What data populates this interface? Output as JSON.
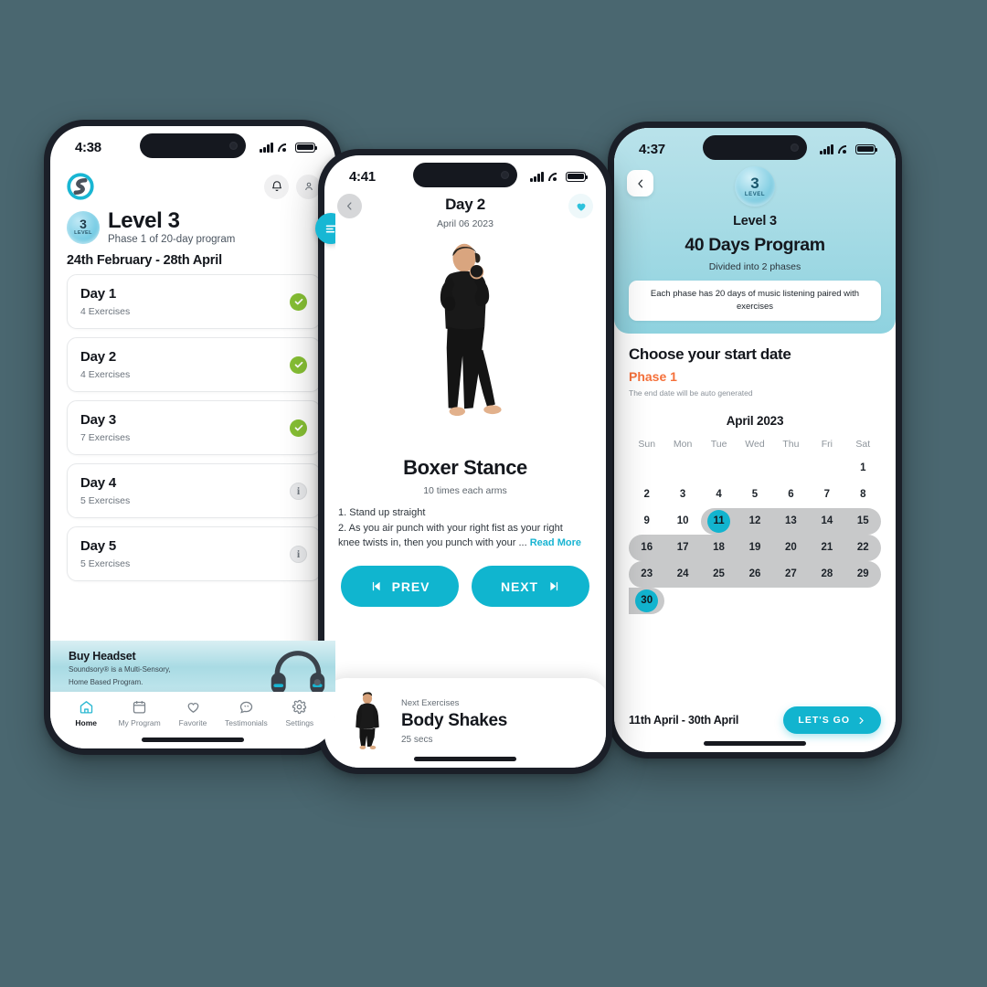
{
  "background_color": "#4a6770",
  "accent_color": "#12b4cf",
  "phone1": {
    "status": {
      "time": "4:38"
    },
    "logo_icon": "soundsory-s-logo-icon",
    "header_icons": [
      {
        "name": "notification-bell-icon",
        "glyph": "bell"
      },
      {
        "name": "account-user-icon",
        "glyph": "user"
      }
    ],
    "level_badge": {
      "number": "3",
      "label": "LEVEL"
    },
    "title": "Level 3",
    "subtitle": "Phase 1 of 20-day program",
    "date_range": "24th February - 28th April",
    "fab_icon": "filter-sort-icon",
    "days": [
      {
        "name": "Day 1",
        "exercises": "4 Exercises",
        "status": "complete"
      },
      {
        "name": "Day 2",
        "exercises": "4 Exercises",
        "status": "complete"
      },
      {
        "name": "Day 3",
        "exercises": "7 Exercises",
        "status": "complete"
      },
      {
        "name": "Day 4",
        "exercises": "5 Exercises",
        "status": "info"
      },
      {
        "name": "Day 5",
        "exercises": "5 Exercises",
        "status": "info"
      }
    ],
    "promo": {
      "title": "Buy Headset",
      "line1": "Soundsory® is a Multi-Sensory,",
      "line2": "Home Based Program.",
      "image": "headphones-icon"
    },
    "tabs": [
      {
        "label": "Home",
        "icon": "home-icon",
        "active": true
      },
      {
        "label": "My Program",
        "icon": "calendar-icon",
        "active": false
      },
      {
        "label": "Favorite",
        "icon": "heart-icon",
        "active": false
      },
      {
        "label": "Testimonials",
        "icon": "quote-bubble-icon",
        "active": false
      },
      {
        "label": "Settings",
        "icon": "gear-icon",
        "active": false
      }
    ]
  },
  "phone2": {
    "status": {
      "time": "4:41"
    },
    "back_icon": "chevron-left-icon",
    "favorite_icon": "heart-filled-icon",
    "title": "Day 2",
    "date": "April 06 2023",
    "hero_image": "boxer-stance-woman-photo",
    "exercise_name": "Boxer Stance",
    "reps": "10 times each arms",
    "steps_line1": "1. Stand up straight",
    "steps_line2": "2. As you air punch with your right fist as your right",
    "steps_line3": "knee twists in, then you punch with your ...",
    "read_more": "Read More",
    "prev_label": "PREV",
    "next_label": "NEXT",
    "next_card": {
      "eyebrow": "Next Exercises",
      "name": "Body Shakes",
      "duration": "25 secs",
      "image": "body-shakes-figure-photo"
    }
  },
  "phone3": {
    "status": {
      "time": "4:37"
    },
    "back_icon": "chevron-left-icon",
    "level_badge": {
      "number": "3",
      "label": "LEVEL"
    },
    "level_text": "Level 3",
    "program_title": "40 Days Program",
    "divided_text": "Divided into 2 phases",
    "note": "Each phase has 20 days of music listening paired with exercises",
    "section_title": "Choose your start date",
    "phase": "Phase 1",
    "auto_note": "The end date will be auto generated",
    "calendar": {
      "month": "April 2023",
      "dow": [
        "Sun",
        "Mon",
        "Tue",
        "Wed",
        "Thu",
        "Fri",
        "Sat"
      ],
      "weeks": [
        [
          {
            "d": ""
          },
          {
            "d": ""
          },
          {
            "d": ""
          },
          {
            "d": ""
          },
          {
            "d": ""
          },
          {
            "d": ""
          },
          {
            "d": "1"
          }
        ],
        [
          {
            "d": "2"
          },
          {
            "d": "3"
          },
          {
            "d": "4"
          },
          {
            "d": "5"
          },
          {
            "d": "6"
          },
          {
            "d": "7"
          },
          {
            "d": "8"
          }
        ],
        [
          {
            "d": "9"
          },
          {
            "d": "10"
          },
          {
            "d": "11",
            "sel": true,
            "range": "start"
          },
          {
            "d": "12",
            "range": "mid"
          },
          {
            "d": "13",
            "range": "mid"
          },
          {
            "d": "14",
            "range": "mid"
          },
          {
            "d": "15",
            "range": "end"
          }
        ],
        [
          {
            "d": "16",
            "range": "start"
          },
          {
            "d": "17",
            "range": "mid"
          },
          {
            "d": "18",
            "range": "mid"
          },
          {
            "d": "19",
            "range": "mid"
          },
          {
            "d": "20",
            "range": "mid"
          },
          {
            "d": "21",
            "range": "mid"
          },
          {
            "d": "22",
            "range": "end"
          }
        ],
        [
          {
            "d": "23",
            "range": "start"
          },
          {
            "d": "24",
            "range": "mid"
          },
          {
            "d": "25",
            "range": "mid"
          },
          {
            "d": "26",
            "range": "mid"
          },
          {
            "d": "27",
            "range": "mid"
          },
          {
            "d": "28",
            "range": "mid"
          },
          {
            "d": "29",
            "range": "end"
          }
        ],
        [
          {
            "d": "30",
            "sel": true,
            "range": "startend"
          },
          {
            "d": ""
          },
          {
            "d": ""
          },
          {
            "d": ""
          },
          {
            "d": ""
          },
          {
            "d": ""
          },
          {
            "d": ""
          }
        ]
      ]
    },
    "selected_range": "11th April - 30th April",
    "cta_label": "LET'S GO",
    "cta_icon": "chevron-right-icon"
  }
}
